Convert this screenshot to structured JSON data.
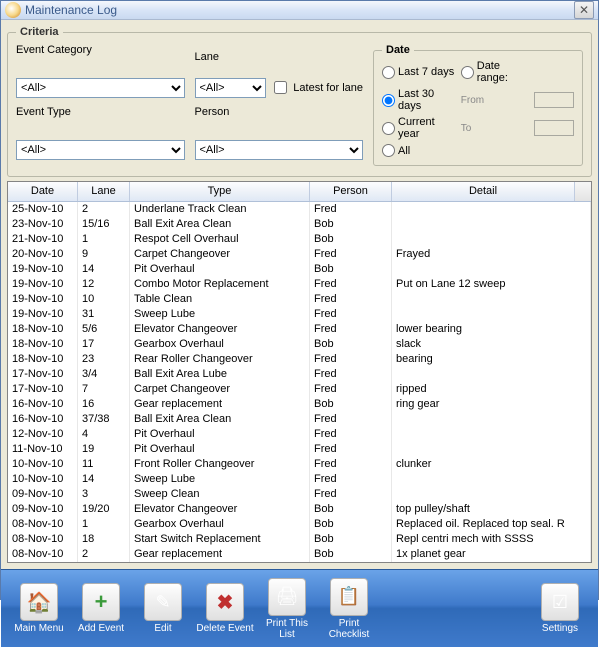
{
  "window": {
    "title": "Maintenance Log"
  },
  "criteria": {
    "legend": "Criteria",
    "event_category_label": "Event Category",
    "event_category_value": "<All>",
    "lane_label": "Lane",
    "lane_value": "<All>",
    "latest_for_lane_label": "Latest for lane",
    "event_type_label": "Event Type",
    "event_type_value": "<All>",
    "person_label": "Person",
    "person_value": "<All>"
  },
  "date": {
    "legend": "Date",
    "last7": "Last 7 days",
    "last30": "Last 30 days",
    "current_year": "Current year",
    "all": "All",
    "date_range": "Date range:",
    "from": "From",
    "to": "To",
    "selected": "last30"
  },
  "columns": {
    "date": "Date",
    "lane": "Lane",
    "type": "Type",
    "person": "Person",
    "detail": "Detail"
  },
  "rows": [
    {
      "date": "25-Nov-10",
      "lane": "2",
      "type": "Underlane Track Clean",
      "person": "Fred",
      "detail": ""
    },
    {
      "date": "23-Nov-10",
      "lane": "15/16",
      "type": "Ball Exit Area Clean",
      "person": "Bob",
      "detail": ""
    },
    {
      "date": "21-Nov-10",
      "lane": "1",
      "type": "Respot Cell Overhaul",
      "person": "Bob",
      "detail": ""
    },
    {
      "date": "20-Nov-10",
      "lane": "9",
      "type": "Carpet Changeover",
      "person": "Fred",
      "detail": "Frayed"
    },
    {
      "date": "19-Nov-10",
      "lane": "14",
      "type": "Pit Overhaul",
      "person": "Bob",
      "detail": ""
    },
    {
      "date": "19-Nov-10",
      "lane": "12",
      "type": "Combo Motor Replacement",
      "person": "Fred",
      "detail": "Put on Lane 12 sweep"
    },
    {
      "date": "19-Nov-10",
      "lane": "10",
      "type": "Table Clean",
      "person": "Fred",
      "detail": ""
    },
    {
      "date": "19-Nov-10",
      "lane": "31",
      "type": "Sweep Lube",
      "person": "Fred",
      "detail": ""
    },
    {
      "date": "18-Nov-10",
      "lane": "5/6",
      "type": "Elevator Changeover",
      "person": "Fred",
      "detail": "lower bearing"
    },
    {
      "date": "18-Nov-10",
      "lane": "17",
      "type": "Gearbox Overhaul",
      "person": "Bob",
      "detail": "slack"
    },
    {
      "date": "18-Nov-10",
      "lane": "23",
      "type": "Rear Roller Changeover",
      "person": "Fred",
      "detail": "bearing"
    },
    {
      "date": "17-Nov-10",
      "lane": "3/4",
      "type": "Ball Exit Area Lube",
      "person": "Fred",
      "detail": ""
    },
    {
      "date": "17-Nov-10",
      "lane": "7",
      "type": "Carpet Changeover",
      "person": "Fred",
      "detail": "ripped"
    },
    {
      "date": "16-Nov-10",
      "lane": "16",
      "type": "Gear replacement",
      "person": "Bob",
      "detail": "ring gear"
    },
    {
      "date": "16-Nov-10",
      "lane": "37/38",
      "type": "Ball Exit Area Clean",
      "person": "Fred",
      "detail": ""
    },
    {
      "date": "12-Nov-10",
      "lane": "4",
      "type": "Pit Overhaul",
      "person": "Fred",
      "detail": ""
    },
    {
      "date": "11-Nov-10",
      "lane": "19",
      "type": "Pit Overhaul",
      "person": "Fred",
      "detail": ""
    },
    {
      "date": "10-Nov-10",
      "lane": "11",
      "type": "Front Roller Changeover",
      "person": "Fred",
      "detail": "clunker"
    },
    {
      "date": "10-Nov-10",
      "lane": "14",
      "type": "Sweep Lube",
      "person": "Fred",
      "detail": ""
    },
    {
      "date": "09-Nov-10",
      "lane": "3",
      "type": "Sweep Clean",
      "person": "Fred",
      "detail": ""
    },
    {
      "date": "09-Nov-10",
      "lane": "19/20",
      "type": "Elevator Changeover",
      "person": "Bob",
      "detail": "top pulley/shaft"
    },
    {
      "date": "08-Nov-10",
      "lane": "1",
      "type": "Gearbox Overhaul",
      "person": "Bob",
      "detail": "Replaced oil. Replaced top seal. R"
    },
    {
      "date": "08-Nov-10",
      "lane": "18",
      "type": "Start Switch Replacement",
      "person": "Bob",
      "detail": "Repl centri mech with SSSS"
    },
    {
      "date": "08-Nov-10",
      "lane": "2",
      "type": "Gear replacement",
      "person": "Bob",
      "detail": "1x planet gear"
    }
  ],
  "toolbar": {
    "main_menu": "Main Menu",
    "add_event": "Add Event",
    "edit": "Edit",
    "delete_event": "Delete Event",
    "print_list": "Print This List",
    "print_checklist": "Print Checklist",
    "settings": "Settings"
  }
}
